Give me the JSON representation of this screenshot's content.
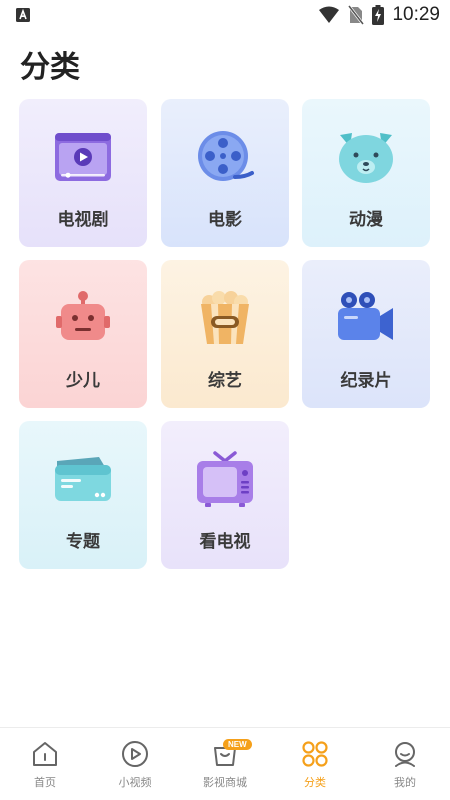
{
  "status_bar": {
    "time": "10:29",
    "icons": [
      "app-notification-icon",
      "wifi-icon",
      "no-sim-icon",
      "battery-charging-icon"
    ]
  },
  "page": {
    "title": "分类"
  },
  "categories": [
    {
      "label": "电视剧",
      "icon": "tv-series-icon"
    },
    {
      "label": "电影",
      "icon": "film-reel-icon"
    },
    {
      "label": "动漫",
      "icon": "anime-bear-icon"
    },
    {
      "label": "少儿",
      "icon": "robot-icon"
    },
    {
      "label": "综艺",
      "icon": "popcorn-icon"
    },
    {
      "label": "纪录片",
      "icon": "movie-camera-icon"
    },
    {
      "label": "专题",
      "icon": "folder-icon"
    },
    {
      "label": "看电视",
      "icon": "retro-tv-icon"
    }
  ],
  "tabbar": {
    "active_color": "#f5a01a",
    "items": [
      {
        "label": "首页",
        "icon": "home-icon"
      },
      {
        "label": "小视频",
        "icon": "play-circle-icon"
      },
      {
        "label": "影视商城",
        "icon": "shop-bag-icon",
        "badge": "NEW"
      },
      {
        "label": "分类",
        "icon": "category-grid-icon",
        "active": true
      },
      {
        "label": "我的",
        "icon": "profile-icon"
      }
    ]
  }
}
